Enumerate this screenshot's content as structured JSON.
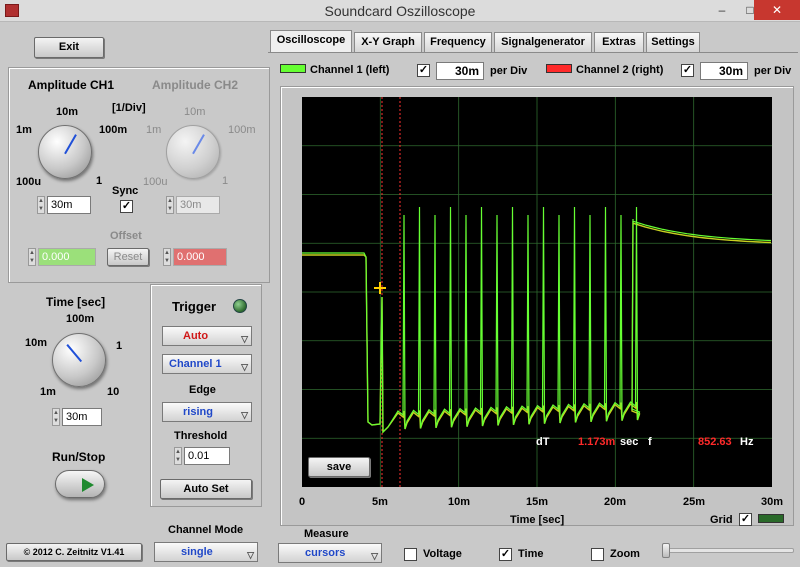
{
  "window": {
    "title": "Soundcard Oszilloscope"
  },
  "left": {
    "exit_label": "Exit",
    "amp_ch1_title": "Amplitude CH1",
    "amp_ch2_title": "Amplitude CH2",
    "div_label": "[1/Div]",
    "amp_scale": {
      "s1m": "1m",
      "s10m": "10m",
      "s100m": "100m",
      "s1": "1",
      "s100u": "100u"
    },
    "sync_label": "Sync",
    "sync_checked": "✓",
    "ch1_value": "30m",
    "ch2_value": "30m",
    "offset_label": "Offset",
    "offset_ch1": "0.000",
    "offset_ch2": "0.000",
    "reset_label": "Reset",
    "time_title": "Time [sec]",
    "time_scale": {
      "t100m": "100m",
      "t10m": "10m",
      "t1": "1",
      "t1m": "1m",
      "t10": "10"
    },
    "time_value": "30m",
    "runstop_label": "Run/Stop",
    "copyright": "© 2012  C. Zeitnitz V1.41"
  },
  "trigger": {
    "title": "Trigger",
    "mode": "Auto",
    "channel": "Channel 1",
    "edge_label": "Edge",
    "edge": "rising",
    "threshold_label": "Threshold",
    "threshold": "0.01",
    "autoset_label": "Auto Set"
  },
  "channel_mode": {
    "label": "Channel Mode",
    "value": "single"
  },
  "tabs": [
    "Oscilloscope",
    "X-Y Graph",
    "Frequency",
    "Signalgenerator",
    "Extras",
    "Settings"
  ],
  "channels": {
    "ch1_label": "Channel 1 (left)",
    "ch1_div": "30m",
    "ch2_label": "Channel 2 (right)",
    "ch2_div": "30m",
    "per_div": "per Div",
    "check": "✓",
    "ch1_color": "#66ff33",
    "ch2_color": "#ff2a2a"
  },
  "readout": {
    "dt_label": "dT",
    "dt_value": "1.173m",
    "sec": "sec",
    "f_label": "f",
    "f_value": "852.63",
    "hz": "Hz"
  },
  "save_label": "save",
  "xaxis": {
    "ticks": [
      "0",
      "5m",
      "10m",
      "15m",
      "20m",
      "25m",
      "30m"
    ],
    "label": "Time [sec]"
  },
  "grid_label": "Grid",
  "grid_check": "✓",
  "measure": {
    "label": "Measure",
    "mode": "cursors",
    "voltage_label": "Voltage",
    "time_label": "Time",
    "time_check": "✓",
    "zoom_label": "Zoom"
  }
}
